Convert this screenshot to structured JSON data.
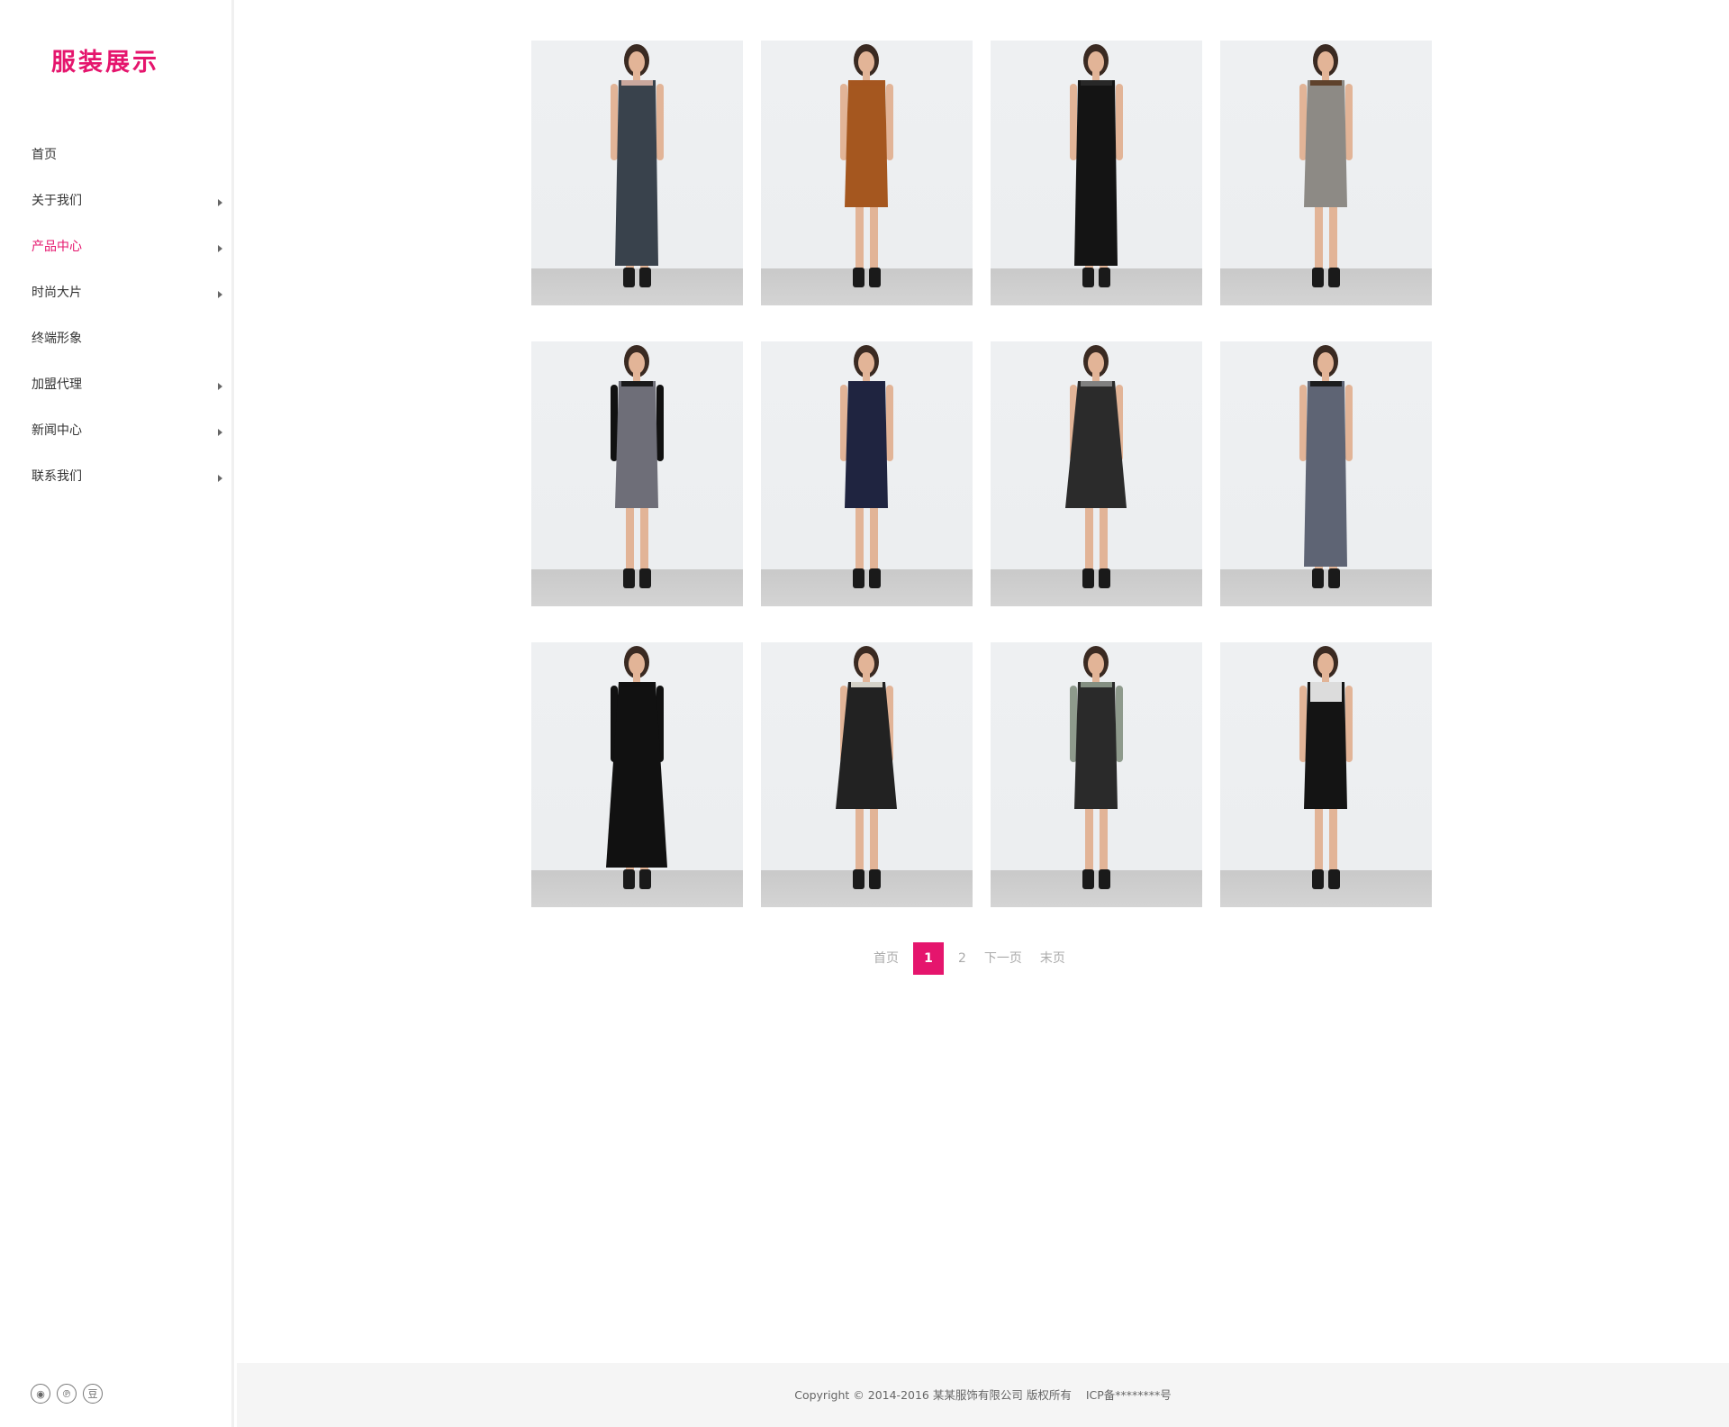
{
  "logo": {
    "text": "服装展示",
    "color": "#e5156d"
  },
  "nav": {
    "items": [
      {
        "label": "首页",
        "has_submenu": false,
        "active": false
      },
      {
        "label": "关于我们",
        "has_submenu": true,
        "active": false
      },
      {
        "label": "产品中心",
        "has_submenu": true,
        "active": true
      },
      {
        "label": "时尚大片",
        "has_submenu": true,
        "active": false
      },
      {
        "label": "终端形象",
        "has_submenu": false,
        "active": false
      },
      {
        "label": "加盟代理",
        "has_submenu": true,
        "active": false
      },
      {
        "label": "新闻中心",
        "has_submenu": true,
        "active": false
      },
      {
        "label": "联系我们",
        "has_submenu": true,
        "active": false
      }
    ]
  },
  "social": [
    {
      "icon": "weibo-icon",
      "glyph": "◉"
    },
    {
      "icon": "pinterest-icon",
      "glyph": "℗"
    },
    {
      "icon": "douban-icon",
      "glyph": "豆"
    }
  ],
  "products": [
    {
      "dress": "#39424c",
      "accent": "#d9b3a6",
      "style": "long-stripe"
    },
    {
      "dress": "#a5571f",
      "accent": "#a5571f",
      "style": "sheath"
    },
    {
      "dress": "#141414",
      "accent": "#2a2a2a",
      "style": "long-lace"
    },
    {
      "dress": "#8d8a85",
      "accent": "#5a3a22",
      "style": "short-print"
    },
    {
      "dress": "#6e6e78",
      "accent": "#111111",
      "style": "jacket"
    },
    {
      "dress": "#1f2440",
      "accent": "#1f2440",
      "style": "shift"
    },
    {
      "dress": "#2b2b2b",
      "accent": "#8a8a8a",
      "style": "flare"
    },
    {
      "dress": "#5e6474",
      "accent": "#151515",
      "style": "long-sheer"
    },
    {
      "dress": "#111111",
      "accent": "#111111",
      "style": "flare-long-sleeve"
    },
    {
      "dress": "#222222",
      "accent": "#e8e4da",
      "style": "floral-skirt"
    },
    {
      "dress": "#2a2a2a",
      "accent": "#8e9a8c",
      "style": "print-sleeve"
    },
    {
      "dress": "#141414",
      "accent": "#f2f2f2",
      "style": "colorblock"
    }
  ],
  "pagination": {
    "first": "首页",
    "current": "1",
    "next_page_num": "2",
    "next": "下一页",
    "last": "末页"
  },
  "footer": {
    "copyright": "Copyright © 2014-2016 某某服饰有限公司 版权所有",
    "icp": "ICP备********号"
  }
}
